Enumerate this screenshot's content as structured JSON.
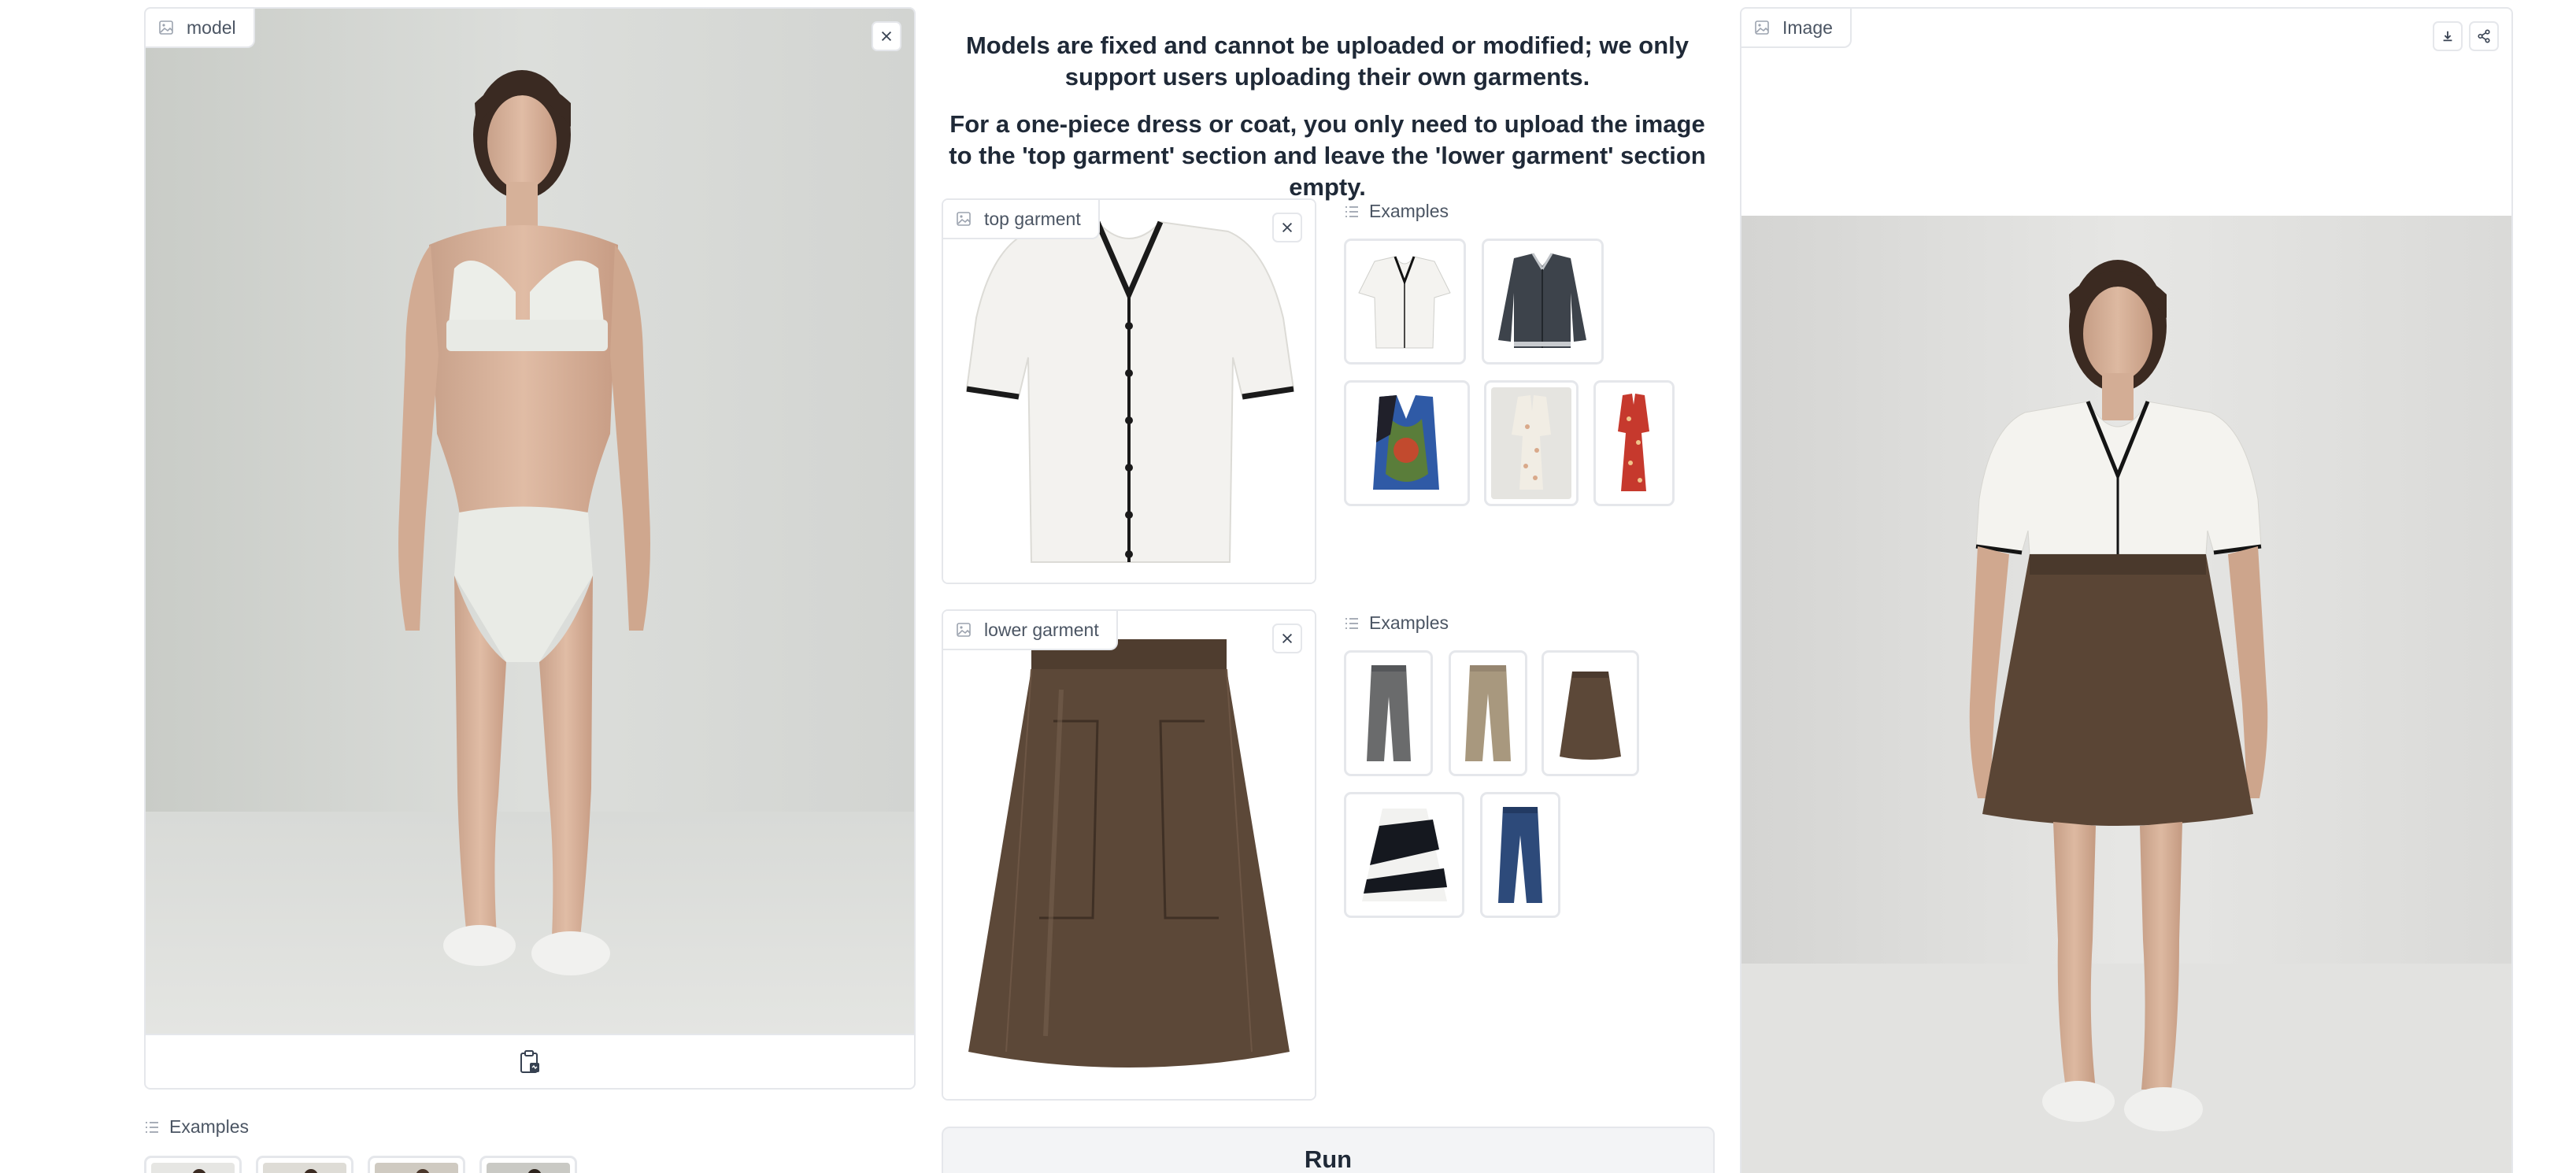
{
  "model_panel": {
    "label": "model",
    "icon": "image-icon"
  },
  "model_examples": {
    "label": "Examples",
    "icon": "list-icon"
  },
  "notice": {
    "line1": "Models are fixed and cannot be uploaded or modified; we only support users uploading their own garments.",
    "line2": "For a one-piece dress or coat, you only need to upload the image to the 'top garment' section and leave the 'lower garment' section empty."
  },
  "top_garment": {
    "label": "top garment"
  },
  "top_examples": {
    "label": "Examples",
    "items": [
      "white blouse",
      "grey polo cardigan",
      "patterned vest",
      "floral dress",
      "red floral dress"
    ]
  },
  "lower_garment": {
    "label": "lower garment"
  },
  "lower_examples": {
    "label": "Examples",
    "items": [
      "grey trousers",
      "khaki trousers",
      "brown leather skirt",
      "striped skirt",
      "blue jeans"
    ]
  },
  "run_button": {
    "label": "Run"
  },
  "output_panel": {
    "label": "Image"
  },
  "colors": {
    "accent": "#f3f4f6",
    "border": "#e5e7eb",
    "text": "#1f2937"
  }
}
